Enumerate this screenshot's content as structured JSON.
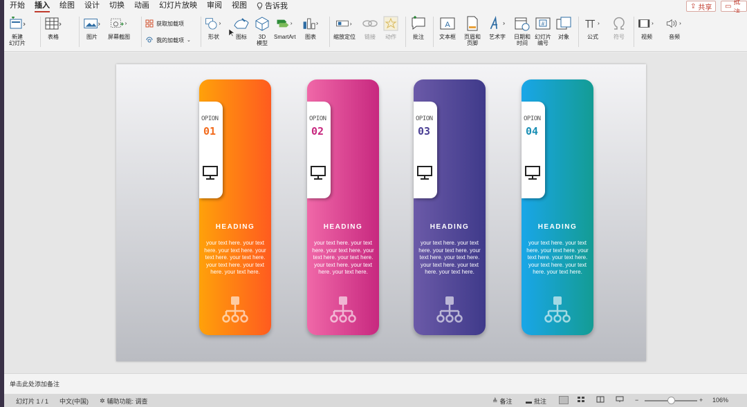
{
  "tabs": [
    {
      "label": "开始"
    },
    {
      "label": "插入"
    },
    {
      "label": "绘图"
    },
    {
      "label": "设计"
    },
    {
      "label": "切换"
    },
    {
      "label": "动画"
    },
    {
      "label": "幻灯片放映"
    },
    {
      "label": "审阅"
    },
    {
      "label": "视图"
    }
  ],
  "tell_me": "告诉我",
  "share_label": "共享",
  "comments_label": "批注",
  "ribbon": {
    "new_slide": "新建\n幻灯片",
    "table": "表格",
    "picture": "图片",
    "screenshot": "屏幕截图",
    "get_addins": "获取加载项",
    "my_addins": "我的加载项",
    "shapes": "形状",
    "icons": "图标",
    "model3d": "3D\n模型",
    "smartart": "SmartArt",
    "chart": "图表",
    "zoom": "缩放定位",
    "link": "链接",
    "action": "动作",
    "comment": "批注",
    "textbox": "文本框",
    "header_footer": "页眉和\n页脚",
    "wordart": "艺术字",
    "datetime": "日期和\n时间",
    "slide_number": "幻灯片\n编号",
    "object": "对象",
    "equation": "公式",
    "symbol": "符号",
    "video": "视频",
    "audio": "音频"
  },
  "cards": [
    {
      "opion": "OPION",
      "num": "01",
      "heading": "HEADING",
      "body": "your text here. your text here. your text here. your text here. your text here. your text here. your text here. your text here.",
      "color_top": "#ffa10a",
      "color_bottom": "#ff5b1f",
      "num_color": "#f26b1d"
    },
    {
      "opion": "OPION",
      "num": "02",
      "heading": "HEADING",
      "body": "your text here. your text here. your text here. your text here. your text here. your text here. your text here. your text here.",
      "color_top": "#f068a8",
      "color_bottom": "#c7287f",
      "num_color": "#c7287f"
    },
    {
      "opion": "OPION",
      "num": "03",
      "heading": "HEADING",
      "body": "your text here. your text here. your text here. your text here. your text here. your text here. your text here. your text here.",
      "color_top": "#6b5aa8",
      "color_bottom": "#3f3a8a",
      "num_color": "#4a3f94"
    },
    {
      "opion": "OPION",
      "num": "04",
      "heading": "HEADING",
      "body": "your text here. your text here. your text here. your text here. your text here. your text here. your text here. your text here.",
      "color_top": "#19a6e8",
      "color_bottom": "#149c94",
      "num_color": "#1a8fb5"
    }
  ],
  "notes_placeholder": "单击此处添加备注",
  "status": {
    "slide_info": "幻灯片 1 / 1",
    "language": "中文(中国)",
    "accessibility": "辅助功能: 调查",
    "notes_btn": "备注",
    "comments_btn": "批注",
    "zoom": "106%"
  },
  "accent": "#c0392b"
}
